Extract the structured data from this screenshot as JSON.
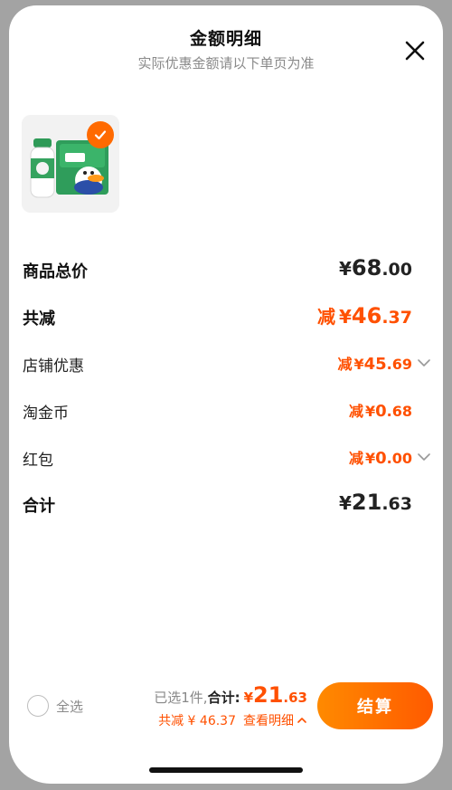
{
  "header": {
    "title": "金额明细",
    "subtitle": "实际优惠金额请以下单页为准"
  },
  "rows": [
    {
      "label": "商品总价",
      "prefix": "",
      "currency": "¥",
      "int": "68",
      "dec": ".00"
    },
    {
      "label": "共减",
      "prefix": "减",
      "currency": "¥",
      "int": "46",
      "dec": ".37"
    },
    {
      "label": "店铺优惠",
      "prefix": "减",
      "currency": "¥",
      "int": "45",
      "dec": ".69"
    },
    {
      "label": "淘金币",
      "prefix": "减",
      "currency": "¥",
      "int": "0",
      "dec": ".68"
    },
    {
      "label": "红包",
      "prefix": "减",
      "currency": "¥",
      "int": "0",
      "dec": ".00"
    },
    {
      "label": "合计",
      "prefix": "",
      "currency": "¥",
      "int": "21",
      "dec": ".63"
    }
  ],
  "footer": {
    "select_all": "全选",
    "selected_text": "已选1件,",
    "total_label": "合计:",
    "total_currency": "¥ ",
    "total_int": "21",
    "total_dec": ".63",
    "discount_text": "共减 ¥ 46.37",
    "detail_link": "查看明细",
    "checkout": "结算"
  },
  "colors": {
    "accent": "#ff5000",
    "checkout_start": "#ff8a00",
    "checkout_end": "#ff5a00"
  }
}
